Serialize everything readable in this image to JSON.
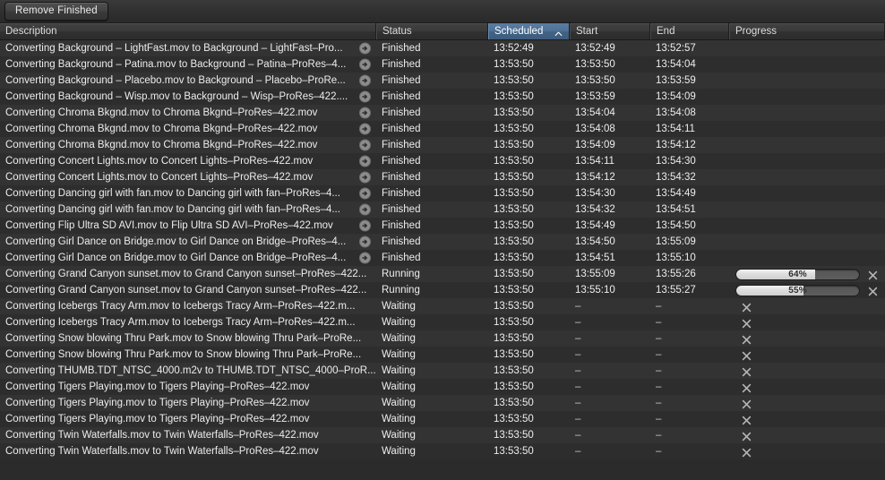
{
  "toolbar": {
    "remove_finished_label": "Remove Finished"
  },
  "columns": [
    {
      "key": "description",
      "label": "Description",
      "sorted": false
    },
    {
      "key": "status",
      "label": "Status",
      "sorted": false
    },
    {
      "key": "scheduled",
      "label": "Scheduled",
      "sorted": true,
      "sort_direction": "ascending",
      "sort_icon": "caret-up-icon"
    },
    {
      "key": "start",
      "label": "Start",
      "sorted": false
    },
    {
      "key": "end",
      "label": "End",
      "sorted": false
    },
    {
      "key": "progress",
      "label": "Progress",
      "sorted": false
    }
  ],
  "icons": {
    "reveal": "reveal-arrow-icon",
    "cancel": "cancel-x-icon",
    "sort": "caret-up-icon"
  },
  "colors": {
    "sorted_header": "#4e7196",
    "row_even": "#333333",
    "row_odd": "#2d2d2d",
    "progress_fill": "#dcdcdc",
    "progress_track": "#5e5e5e",
    "text": "#ededed"
  },
  "rows": [
    {
      "description": "Converting Background – LightFast.mov to Background – LightFast–Pro...",
      "status": "Finished",
      "scheduled": "13:52:49",
      "start": "13:52:49",
      "end": "13:52:57",
      "reveal": true,
      "progress": null,
      "cancel": false
    },
    {
      "description": "Converting Background – Patina.mov to Background – Patina–ProRes–4...",
      "status": "Finished",
      "scheduled": "13:53:50",
      "start": "13:53:50",
      "end": "13:54:04",
      "reveal": true,
      "progress": null,
      "cancel": false
    },
    {
      "description": "Converting Background – Placebo.mov to Background – Placebo–ProRe...",
      "status": "Finished",
      "scheduled": "13:53:50",
      "start": "13:53:50",
      "end": "13:53:59",
      "reveal": true,
      "progress": null,
      "cancel": false
    },
    {
      "description": "Converting Background – Wisp.mov to Background – Wisp–ProRes–422....",
      "status": "Finished",
      "scheduled": "13:53:50",
      "start": "13:53:59",
      "end": "13:54:09",
      "reveal": true,
      "progress": null,
      "cancel": false
    },
    {
      "description": "Converting Chroma Bkgnd.mov to Chroma Bkgnd–ProRes–422.mov",
      "status": "Finished",
      "scheduled": "13:53:50",
      "start": "13:54:04",
      "end": "13:54:08",
      "reveal": true,
      "progress": null,
      "cancel": false
    },
    {
      "description": "Converting Chroma Bkgnd.mov to Chroma Bkgnd–ProRes–422.mov",
      "status": "Finished",
      "scheduled": "13:53:50",
      "start": "13:54:08",
      "end": "13:54:11",
      "reveal": true,
      "progress": null,
      "cancel": false
    },
    {
      "description": "Converting Chroma Bkgnd.mov to Chroma Bkgnd–ProRes–422.mov",
      "status": "Finished",
      "scheduled": "13:53:50",
      "start": "13:54:09",
      "end": "13:54:12",
      "reveal": true,
      "progress": null,
      "cancel": false
    },
    {
      "description": "Converting Concert Lights.mov to Concert Lights–ProRes–422.mov",
      "status": "Finished",
      "scheduled": "13:53:50",
      "start": "13:54:11",
      "end": "13:54:30",
      "reveal": true,
      "progress": null,
      "cancel": false
    },
    {
      "description": "Converting Concert Lights.mov to Concert Lights–ProRes–422.mov",
      "status": "Finished",
      "scheduled": "13:53:50",
      "start": "13:54:12",
      "end": "13:54:32",
      "reveal": true,
      "progress": null,
      "cancel": false
    },
    {
      "description": "Converting Dancing girl with fan.mov to Dancing girl with fan–ProRes–4...",
      "status": "Finished",
      "scheduled": "13:53:50",
      "start": "13:54:30",
      "end": "13:54:49",
      "reveal": true,
      "progress": null,
      "cancel": false
    },
    {
      "description": "Converting Dancing girl with fan.mov to Dancing girl with fan–ProRes–4...",
      "status": "Finished",
      "scheduled": "13:53:50",
      "start": "13:54:32",
      "end": "13:54:51",
      "reveal": true,
      "progress": null,
      "cancel": false
    },
    {
      "description": "Converting Flip Ultra SD AVI.mov to Flip Ultra SD AVI–ProRes–422.mov",
      "status": "Finished",
      "scheduled": "13:53:50",
      "start": "13:54:49",
      "end": "13:54:50",
      "reveal": true,
      "progress": null,
      "cancel": false
    },
    {
      "description": "Converting Girl Dance on Bridge.mov to Girl Dance on Bridge–ProRes–4...",
      "status": "Finished",
      "scheduled": "13:53:50",
      "start": "13:54:50",
      "end": "13:55:09",
      "reveal": true,
      "progress": null,
      "cancel": false
    },
    {
      "description": "Converting Girl Dance on Bridge.mov to Girl Dance on Bridge–ProRes–4...",
      "status": "Finished",
      "scheduled": "13:53:50",
      "start": "13:54:51",
      "end": "13:55:10",
      "reveal": true,
      "progress": null,
      "cancel": false
    },
    {
      "description": "Converting Grand Canyon sunset.mov to Grand Canyon sunset–ProRes–422...",
      "status": "Running",
      "scheduled": "13:53:50",
      "start": "13:55:09",
      "end": "13:55:26",
      "reveal": false,
      "progress": 64,
      "progress_label": "64%",
      "cancel": true
    },
    {
      "description": "Converting Grand Canyon sunset.mov to Grand Canyon sunset–ProRes–422...",
      "status": "Running",
      "scheduled": "13:53:50",
      "start": "13:55:10",
      "end": "13:55:27",
      "reveal": false,
      "progress": 55,
      "progress_label": "55%",
      "cancel": true
    },
    {
      "description": "Converting Icebergs Tracy Arm.mov to Icebergs Tracy Arm–ProRes–422.m...",
      "status": "Waiting",
      "scheduled": "13:53:50",
      "start": "–",
      "end": "–",
      "reveal": false,
      "progress": null,
      "cancel": true
    },
    {
      "description": "Converting Icebergs Tracy Arm.mov to Icebergs Tracy Arm–ProRes–422.m...",
      "status": "Waiting",
      "scheduled": "13:53:50",
      "start": "–",
      "end": "–",
      "reveal": false,
      "progress": null,
      "cancel": true
    },
    {
      "description": "Converting Snow blowing Thru Park.mov to Snow blowing Thru Park–ProRe...",
      "status": "Waiting",
      "scheduled": "13:53:50",
      "start": "–",
      "end": "–",
      "reveal": false,
      "progress": null,
      "cancel": true
    },
    {
      "description": "Converting Snow blowing Thru Park.mov to Snow blowing Thru Park–ProRe...",
      "status": "Waiting",
      "scheduled": "13:53:50",
      "start": "–",
      "end": "–",
      "reveal": false,
      "progress": null,
      "cancel": true
    },
    {
      "description": "Converting THUMB.TDT_NTSC_4000.m2v to THUMB.TDT_NTSC_4000–ProR...",
      "status": "Waiting",
      "scheduled": "13:53:50",
      "start": "–",
      "end": "–",
      "reveal": false,
      "progress": null,
      "cancel": true
    },
    {
      "description": "Converting Tigers Playing.mov to Tigers Playing–ProRes–422.mov",
      "status": "Waiting",
      "scheduled": "13:53:50",
      "start": "–",
      "end": "–",
      "reveal": false,
      "progress": null,
      "cancel": true
    },
    {
      "description": "Converting Tigers Playing.mov to Tigers Playing–ProRes–422.mov",
      "status": "Waiting",
      "scheduled": "13:53:50",
      "start": "–",
      "end": "–",
      "reveal": false,
      "progress": null,
      "cancel": true
    },
    {
      "description": "Converting Tigers Playing.mov to Tigers Playing–ProRes–422.mov",
      "status": "Waiting",
      "scheduled": "13:53:50",
      "start": "–",
      "end": "–",
      "reveal": false,
      "progress": null,
      "cancel": true
    },
    {
      "description": "Converting Twin Waterfalls.mov to Twin Waterfalls–ProRes–422.mov",
      "status": "Waiting",
      "scheduled": "13:53:50",
      "start": "–",
      "end": "–",
      "reveal": false,
      "progress": null,
      "cancel": true
    },
    {
      "description": "Converting Twin Waterfalls.mov to Twin Waterfalls–ProRes–422.mov",
      "status": "Waiting",
      "scheduled": "13:53:50",
      "start": "–",
      "end": "–",
      "reveal": false,
      "progress": null,
      "cancel": true
    }
  ]
}
